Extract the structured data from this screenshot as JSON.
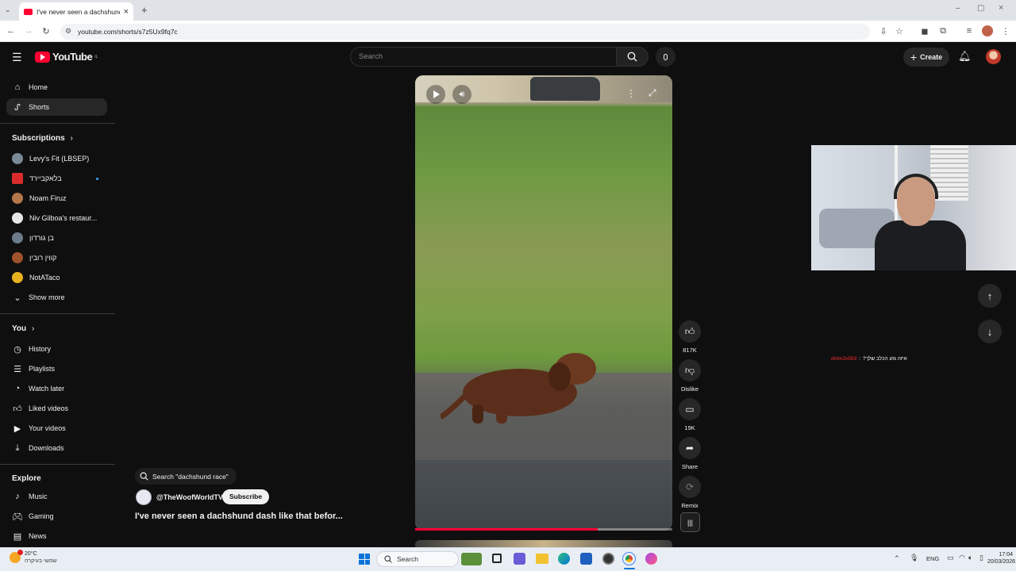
{
  "browser": {
    "tab_title": "I've never seen a dachshund da",
    "url": "youtube.com/shorts/s7z5Ux9fq7c"
  },
  "header": {
    "logo_text": "YouTube",
    "logo_region": "IL",
    "search_placeholder": "Search",
    "create_label": "Create"
  },
  "sidebar": {
    "main": [
      {
        "label": "Home",
        "icon": "home-icon"
      },
      {
        "label": "Shorts",
        "icon": "shorts-icon"
      }
    ],
    "subscriptions_heading": "Subscriptions",
    "subscriptions": [
      {
        "label": "Levy's Fit (LBSEP)",
        "color": "#7a8a99"
      },
      {
        "label": "בלאקביירד",
        "color": "#d92b2b"
      },
      {
        "label": "Noam Firuz",
        "color": "#b5764a"
      },
      {
        "label": "Niv Gilboa's restaur...",
        "color": "#e8e8e8"
      },
      {
        "label": "בן גורדון",
        "color": "#6c7b8a"
      },
      {
        "label": "קווין רובין",
        "color": "#a0522d"
      },
      {
        "label": "NotATaco",
        "color": "#e8b21f"
      }
    ],
    "show_more": "Show more",
    "you_heading": "You",
    "you_items": [
      {
        "label": "History",
        "icon": "history-icon"
      },
      {
        "label": "Playlists",
        "icon": "playlists-icon"
      },
      {
        "label": "Watch later",
        "icon": "watch-later-icon"
      },
      {
        "label": "Liked videos",
        "icon": "liked-icon"
      },
      {
        "label": "Your videos",
        "icon": "your-videos-icon"
      },
      {
        "label": "Downloads",
        "icon": "downloads-icon"
      }
    ],
    "explore_heading": "Explore",
    "explore_items": [
      {
        "label": "Music",
        "icon": "music-icon"
      },
      {
        "label": "Gaming",
        "icon": "gaming-icon"
      },
      {
        "label": "News",
        "icon": "news-icon"
      }
    ]
  },
  "short": {
    "search_chip": "Search \"dachshund race\"",
    "channel": "@TheWoofWorldTV",
    "subscribe_label": "Subscribe",
    "title": "I've never seen a dachshund dash like that befor...",
    "progress": 0.71,
    "actions": {
      "like_count": "817K",
      "dislike_label": "Dislike",
      "comment_count": "19K",
      "share_label": "Share",
      "remix_label": "Remix"
    }
  },
  "overlay": {
    "chat_user": "dmm2v593",
    "chat_message": "איזה גזע הכלב שלך?"
  },
  "taskbar": {
    "weather_temp": "20°C",
    "weather_desc": "שמשי בעיקרה",
    "search_label": "Search",
    "lang": "ENG",
    "time": "17:04",
    "date": "20/03/2026"
  }
}
